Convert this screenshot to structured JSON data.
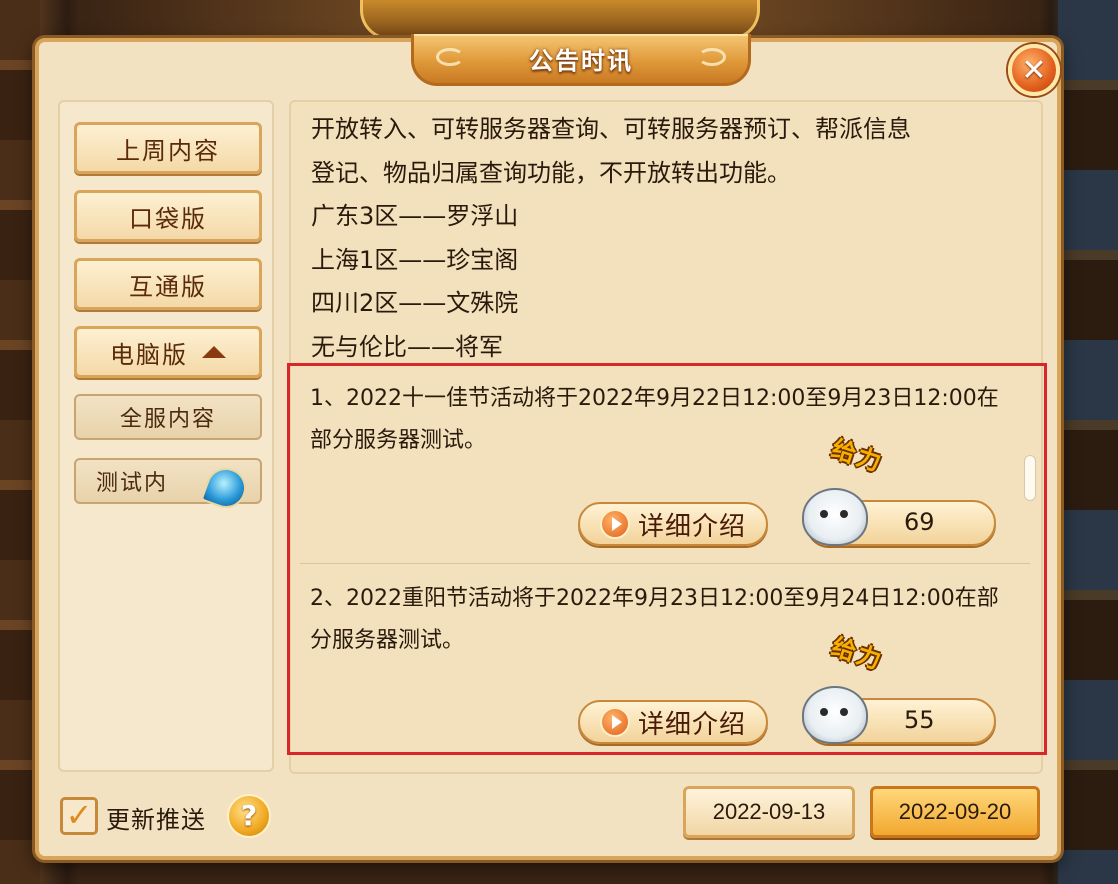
{
  "window": {
    "title": "公告时讯"
  },
  "sidebar": {
    "items": [
      {
        "label": "上周内容"
      },
      {
        "label": "口袋版"
      },
      {
        "label": "互通版"
      },
      {
        "label": "电脑版"
      }
    ],
    "sub_items": [
      {
        "label": "全服内容"
      },
      {
        "label": "测试内"
      }
    ]
  },
  "notice": {
    "lines": [
      "开放转入、可转服务器查询、可转服务器预订、帮派信息",
      "登记、物品归属查询功能，不开放转出功能。",
      "广东3区——罗浮山",
      "上海1区——珍宝阁",
      "四川2区——文殊院",
      "无与伦比——将军"
    ]
  },
  "items": [
    {
      "text": "1、2022十一佳节活动将于2022年9月22日12:00至9月23日12:00在部分服务器测试。",
      "detail_label": "详细介绍",
      "like_tag": "给力",
      "like_count": "69"
    },
    {
      "text": "2、2022重阳节活动将于2022年9月23日12:00至9月24日12:00在部分服务器测试。",
      "detail_label": "详细介绍",
      "like_tag": "给力",
      "like_count": "55"
    }
  ],
  "footer": {
    "push_label": "更新推送",
    "push_checked": true,
    "help": "?",
    "dates": [
      "2022-09-13",
      "2022-09-20"
    ],
    "active_date": "2022-09-20"
  },
  "colors": {
    "panel": "#f3e2c2",
    "accent": "#e09a3a",
    "highlight_border": "#d8262a"
  }
}
